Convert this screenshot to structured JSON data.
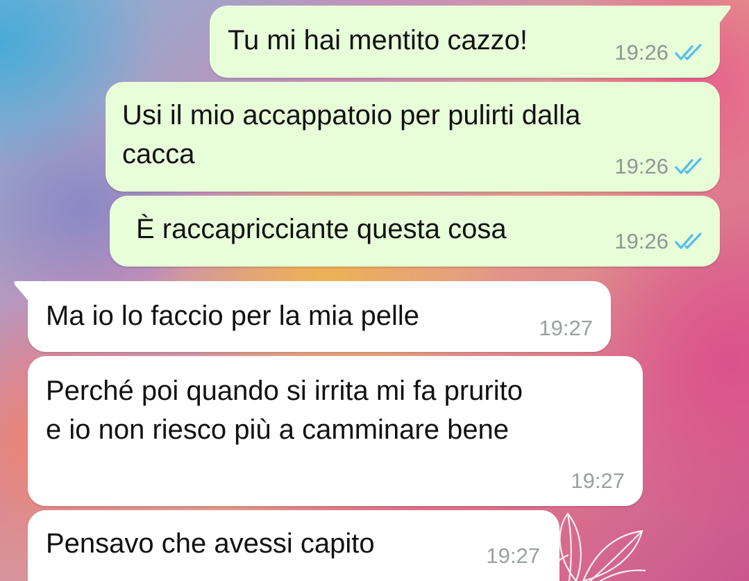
{
  "messages": [
    {
      "direction": "outgoing",
      "lines": [
        "Tu mi hai mentito cazzo!"
      ],
      "time": "19:26",
      "status": "read"
    },
    {
      "direction": "outgoing",
      "lines": [
        "Usi il mio accappatoio per pulirti dalla",
        "cacca"
      ],
      "time": "19:26",
      "status": "read"
    },
    {
      "direction": "outgoing",
      "lines": [
        "È raccapricciante questa cosa"
      ],
      "time": "19:26",
      "status": "read"
    },
    {
      "direction": "incoming",
      "lines": [
        "Ma io lo faccio per la mia pelle"
      ],
      "time": "19:27"
    },
    {
      "direction": "incoming",
      "lines": [
        "Perché poi quando si irrita mi fa prurito",
        "e io non riesco più a camminare bene"
      ],
      "time": "19:27"
    },
    {
      "direction": "incoming",
      "lines": [
        "Pensavo che avessi capito"
      ],
      "time": "19:27"
    }
  ],
  "colors": {
    "outgoing_bubble": "#e7fed9",
    "incoming_bubble": "#ffffff",
    "read_tick": "#53bdeb",
    "timestamp": "#8e9792"
  },
  "icons": {
    "read_receipt": "double-check-icon",
    "wallpaper_decoration": "flower-icon"
  }
}
